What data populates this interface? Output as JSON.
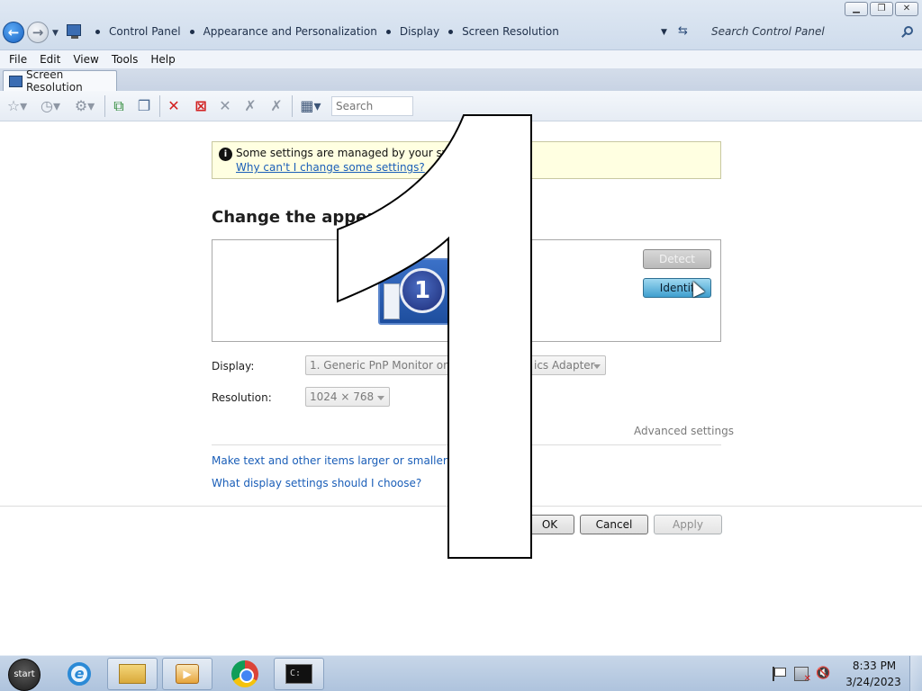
{
  "window": {
    "breadcrumb": [
      "Control Panel",
      "Appearance and Personalization",
      "Display",
      "Screen Resolution"
    ],
    "search_placeholder": "Search Control Panel",
    "controls": {
      "minimize": "▁",
      "restore": "❐",
      "close": "✕"
    }
  },
  "menu": [
    "File",
    "Edit",
    "View",
    "Tools",
    "Help"
  ],
  "tab": {
    "label": "Screen Resolution"
  },
  "toolbar": {
    "search_placeholder": "Search"
  },
  "info": {
    "text": "Some settings are managed by your system",
    "link": "Why can't I change some settings?"
  },
  "heading": "Change the appea",
  "monitor": {
    "number": "1"
  },
  "buttons": {
    "detect": "Detect",
    "identify": "Identif",
    "ok": "OK",
    "cancel": "Cancel",
    "apply": "Apply"
  },
  "fields": {
    "display_label": "Display:",
    "display_value_left": "1. Generic PnP Monitor on Sta",
    "display_value_right": "ics Adapter",
    "resolution_label": "Resolution:",
    "resolution_value": "1024 × 768"
  },
  "links": {
    "advanced": "Advanced settings",
    "larger_text": "Make text and other items larger or smaller",
    "which_settings": "What display settings should I choose?"
  },
  "overlay": {
    "digit": "1"
  },
  "taskbar": {
    "start_label": "start",
    "clock_time": "8:33 PM",
    "clock_date": "3/24/2023"
  },
  "colors": {
    "link": "#1a5eb8",
    "banner": "#ffffe1",
    "identify": "#3f9fcf"
  },
  "icons": [
    "back-arrow-icon",
    "forward-arrow-icon",
    "control-panel-icon",
    "refresh-icon",
    "search-icon",
    "info-icon",
    "ie-icon",
    "explorer-icon",
    "media-player-icon",
    "chrome-icon",
    "cmd-icon",
    "flag-icon",
    "network-icon",
    "volume-muted-icon"
  ]
}
